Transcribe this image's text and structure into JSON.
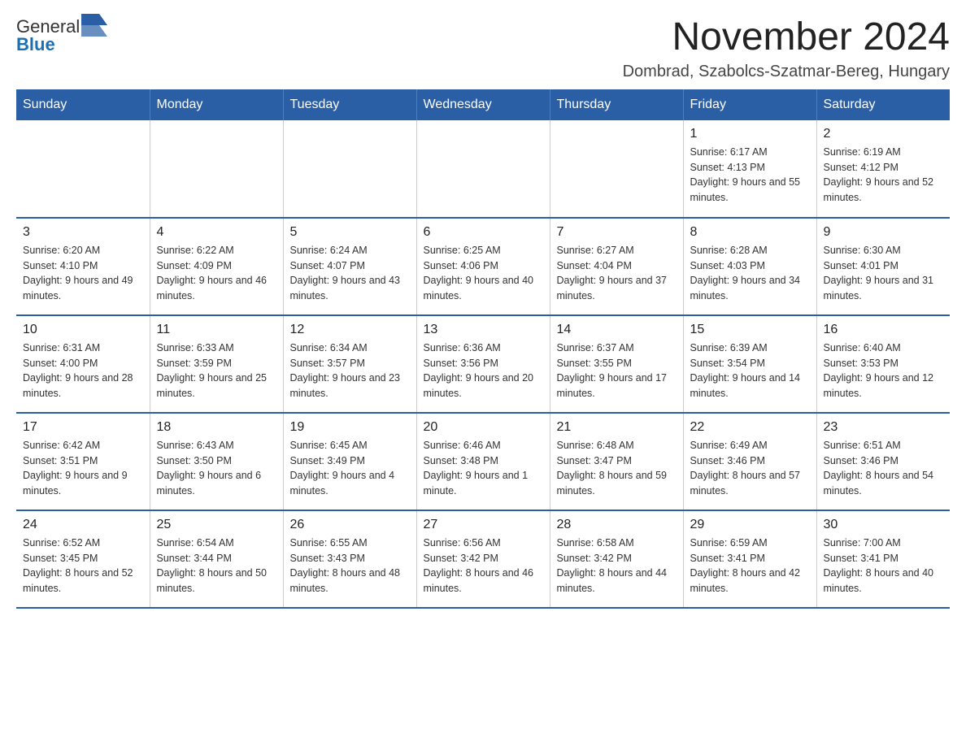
{
  "logo": {
    "text_general": "General",
    "text_blue": "Blue"
  },
  "header": {
    "month_year": "November 2024",
    "location": "Dombrad, Szabolcs-Szatmar-Bereg, Hungary"
  },
  "weekdays": [
    "Sunday",
    "Monday",
    "Tuesday",
    "Wednesday",
    "Thursday",
    "Friday",
    "Saturday"
  ],
  "weeks": [
    [
      {
        "day": "",
        "info": ""
      },
      {
        "day": "",
        "info": ""
      },
      {
        "day": "",
        "info": ""
      },
      {
        "day": "",
        "info": ""
      },
      {
        "day": "",
        "info": ""
      },
      {
        "day": "1",
        "info": "Sunrise: 6:17 AM\nSunset: 4:13 PM\nDaylight: 9 hours and 55 minutes."
      },
      {
        "day": "2",
        "info": "Sunrise: 6:19 AM\nSunset: 4:12 PM\nDaylight: 9 hours and 52 minutes."
      }
    ],
    [
      {
        "day": "3",
        "info": "Sunrise: 6:20 AM\nSunset: 4:10 PM\nDaylight: 9 hours and 49 minutes."
      },
      {
        "day": "4",
        "info": "Sunrise: 6:22 AM\nSunset: 4:09 PM\nDaylight: 9 hours and 46 minutes."
      },
      {
        "day": "5",
        "info": "Sunrise: 6:24 AM\nSunset: 4:07 PM\nDaylight: 9 hours and 43 minutes."
      },
      {
        "day": "6",
        "info": "Sunrise: 6:25 AM\nSunset: 4:06 PM\nDaylight: 9 hours and 40 minutes."
      },
      {
        "day": "7",
        "info": "Sunrise: 6:27 AM\nSunset: 4:04 PM\nDaylight: 9 hours and 37 minutes."
      },
      {
        "day": "8",
        "info": "Sunrise: 6:28 AM\nSunset: 4:03 PM\nDaylight: 9 hours and 34 minutes."
      },
      {
        "day": "9",
        "info": "Sunrise: 6:30 AM\nSunset: 4:01 PM\nDaylight: 9 hours and 31 minutes."
      }
    ],
    [
      {
        "day": "10",
        "info": "Sunrise: 6:31 AM\nSunset: 4:00 PM\nDaylight: 9 hours and 28 minutes."
      },
      {
        "day": "11",
        "info": "Sunrise: 6:33 AM\nSunset: 3:59 PM\nDaylight: 9 hours and 25 minutes."
      },
      {
        "day": "12",
        "info": "Sunrise: 6:34 AM\nSunset: 3:57 PM\nDaylight: 9 hours and 23 minutes."
      },
      {
        "day": "13",
        "info": "Sunrise: 6:36 AM\nSunset: 3:56 PM\nDaylight: 9 hours and 20 minutes."
      },
      {
        "day": "14",
        "info": "Sunrise: 6:37 AM\nSunset: 3:55 PM\nDaylight: 9 hours and 17 minutes."
      },
      {
        "day": "15",
        "info": "Sunrise: 6:39 AM\nSunset: 3:54 PM\nDaylight: 9 hours and 14 minutes."
      },
      {
        "day": "16",
        "info": "Sunrise: 6:40 AM\nSunset: 3:53 PM\nDaylight: 9 hours and 12 minutes."
      }
    ],
    [
      {
        "day": "17",
        "info": "Sunrise: 6:42 AM\nSunset: 3:51 PM\nDaylight: 9 hours and 9 minutes."
      },
      {
        "day": "18",
        "info": "Sunrise: 6:43 AM\nSunset: 3:50 PM\nDaylight: 9 hours and 6 minutes."
      },
      {
        "day": "19",
        "info": "Sunrise: 6:45 AM\nSunset: 3:49 PM\nDaylight: 9 hours and 4 minutes."
      },
      {
        "day": "20",
        "info": "Sunrise: 6:46 AM\nSunset: 3:48 PM\nDaylight: 9 hours and 1 minute."
      },
      {
        "day": "21",
        "info": "Sunrise: 6:48 AM\nSunset: 3:47 PM\nDaylight: 8 hours and 59 minutes."
      },
      {
        "day": "22",
        "info": "Sunrise: 6:49 AM\nSunset: 3:46 PM\nDaylight: 8 hours and 57 minutes."
      },
      {
        "day": "23",
        "info": "Sunrise: 6:51 AM\nSunset: 3:46 PM\nDaylight: 8 hours and 54 minutes."
      }
    ],
    [
      {
        "day": "24",
        "info": "Sunrise: 6:52 AM\nSunset: 3:45 PM\nDaylight: 8 hours and 52 minutes."
      },
      {
        "day": "25",
        "info": "Sunrise: 6:54 AM\nSunset: 3:44 PM\nDaylight: 8 hours and 50 minutes."
      },
      {
        "day": "26",
        "info": "Sunrise: 6:55 AM\nSunset: 3:43 PM\nDaylight: 8 hours and 48 minutes."
      },
      {
        "day": "27",
        "info": "Sunrise: 6:56 AM\nSunset: 3:42 PM\nDaylight: 8 hours and 46 minutes."
      },
      {
        "day": "28",
        "info": "Sunrise: 6:58 AM\nSunset: 3:42 PM\nDaylight: 8 hours and 44 minutes."
      },
      {
        "day": "29",
        "info": "Sunrise: 6:59 AM\nSunset: 3:41 PM\nDaylight: 8 hours and 42 minutes."
      },
      {
        "day": "30",
        "info": "Sunrise: 7:00 AM\nSunset: 3:41 PM\nDaylight: 8 hours and 40 minutes."
      }
    ]
  ]
}
